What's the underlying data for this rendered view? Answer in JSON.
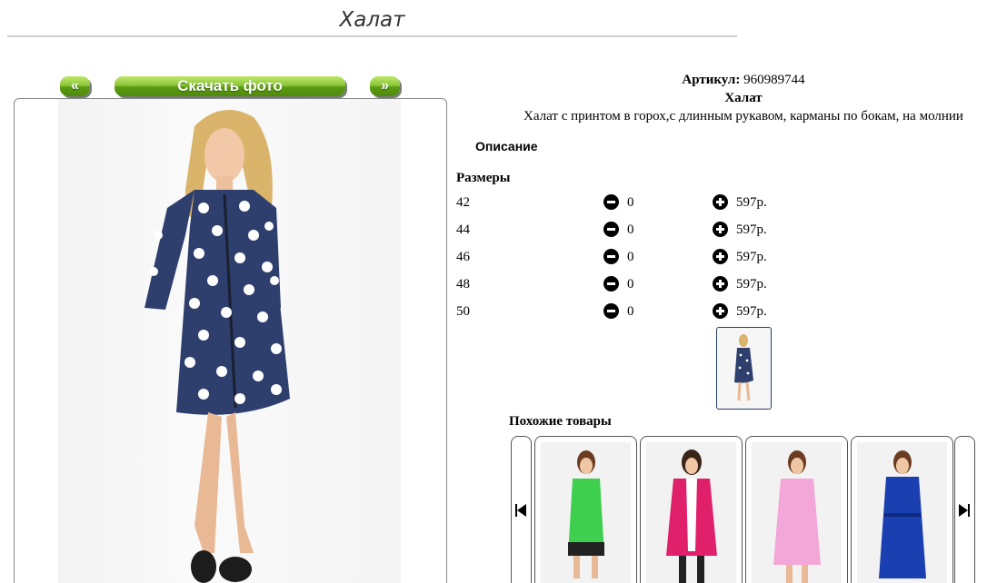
{
  "page": {
    "title": "Халат"
  },
  "photo_nav": {
    "prev_label": "«",
    "download_label": "Скачать фото",
    "next_label": "»"
  },
  "product": {
    "article_label": "Артикул:",
    "article_value": "960989744",
    "name": "Халат",
    "description": "Халат с принтом в горох,с длинным рукавом, карманы по бокам, на молнии"
  },
  "description_heading": "Описание",
  "sizes_heading": "Размеры",
  "sizes": [
    {
      "size": "42",
      "qty": "0",
      "price": "597р."
    },
    {
      "size": "44",
      "qty": "0",
      "price": "597р."
    },
    {
      "size": "46",
      "qty": "0",
      "price": "597р."
    },
    {
      "size": "48",
      "qty": "0",
      "price": "597р."
    },
    {
      "size": "50",
      "qty": "0",
      "price": "597р."
    }
  ],
  "similar": {
    "heading": "Похожие товары",
    "items": [
      {
        "icon": "green-dress-photo",
        "color": "#3fcf4f"
      },
      {
        "icon": "pink-robe-photo",
        "color": "#e0206a"
      },
      {
        "icon": "light-pink-robe-photo",
        "color": "#f3a6d8"
      },
      {
        "icon": "blue-robe-photo",
        "color": "#1a3fb0"
      }
    ]
  },
  "colors": {
    "button_green": "#5a9a12",
    "dress_navy": "#2e3f6e"
  }
}
